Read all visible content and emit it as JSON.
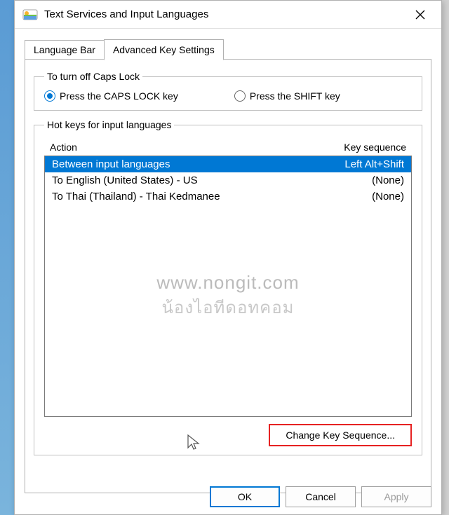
{
  "window": {
    "title": "Text Services and Input Languages"
  },
  "tabs": {
    "language_bar": "Language Bar",
    "advanced": "Advanced Key Settings"
  },
  "caps_group": {
    "legend": "To turn off Caps Lock",
    "radio_caps": "Press the CAPS LOCK key",
    "radio_shift": "Press the SHIFT key"
  },
  "hotkeys_group": {
    "legend": "Hot keys for input languages",
    "col_action": "Action",
    "col_keyseq": "Key sequence",
    "rows": [
      {
        "action": "Between input languages",
        "keyseq": "Left Alt+Shift",
        "selected": true
      },
      {
        "action": "To English (United States) - US",
        "keyseq": "(None)",
        "selected": false
      },
      {
        "action": "To Thai (Thailand) - Thai Kedmanee",
        "keyseq": "(None)",
        "selected": false
      }
    ],
    "change_btn": "Change Key Sequence..."
  },
  "watermark": {
    "line1": "www.nongit.com",
    "line2": "น้องไอทีดอทคอม"
  },
  "footer": {
    "ok": "OK",
    "cancel": "Cancel",
    "apply": "Apply"
  }
}
